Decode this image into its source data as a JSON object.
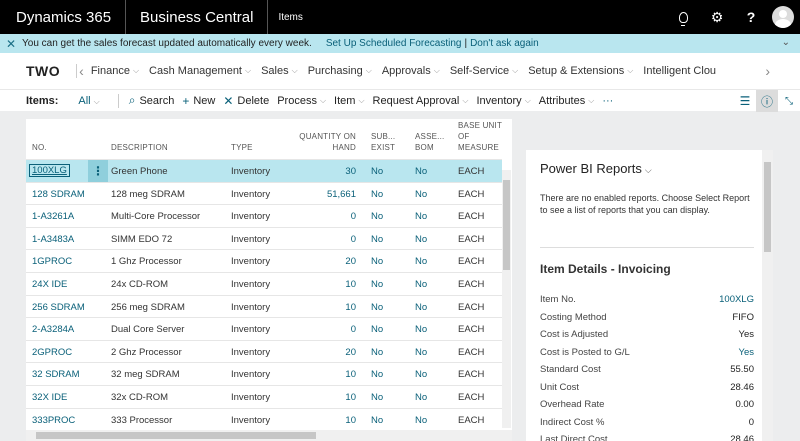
{
  "topbar": {
    "brand": "Dynamics 365",
    "app": "Business Central",
    "page": "Items"
  },
  "notification": {
    "text": "You can get the sales forecast updated automatically every week.",
    "link1": "Set Up Scheduled Forecasting",
    "sep": "|",
    "link2": "Don't ask again"
  },
  "nav": {
    "company": "TWO",
    "items": [
      "Finance",
      "Cash Management",
      "Sales",
      "Purchasing",
      "Approvals",
      "Self-Service",
      "Setup & Extensions",
      "Intelligent Clou"
    ]
  },
  "actions": {
    "title": "Items:",
    "filter": "All",
    "search": "Search",
    "new": "New",
    "delete": "Delete",
    "process": "Process",
    "item": "Item",
    "request_approval": "Request Approval",
    "inventory": "Inventory",
    "attributes": "Attributes",
    "more": "···"
  },
  "grid": {
    "headers": {
      "no": "NO.",
      "description": "DESCRIPTION",
      "type": "TYPE",
      "qty1": "QUANTITY ON",
      "qty2": "HAND",
      "sub1": "SUB...",
      "sub2": "EXIST",
      "asm1": "ASSE...",
      "asm2": "BOM",
      "uom1": "BASE UNIT",
      "uom2": "OF",
      "uom3": "MEASURE"
    },
    "rows": [
      {
        "no": "100XLG",
        "desc": "Green Phone",
        "type": "Inventory",
        "qty": "30",
        "sub": "No",
        "bom": "No",
        "uom": "EACH"
      },
      {
        "no": "128 SDRAM",
        "desc": "128 meg SDRAM",
        "type": "Inventory",
        "qty": "51,661",
        "sub": "No",
        "bom": "No",
        "uom": "EACH"
      },
      {
        "no": "1-A3261A",
        "desc": "Multi-Core Processor",
        "type": "Inventory",
        "qty": "0",
        "sub": "No",
        "bom": "No",
        "uom": "EACH"
      },
      {
        "no": "1-A3483A",
        "desc": "SIMM EDO 72",
        "type": "Inventory",
        "qty": "0",
        "sub": "No",
        "bom": "No",
        "uom": "EACH"
      },
      {
        "no": "1GPROC",
        "desc": "1 Ghz Processor",
        "type": "Inventory",
        "qty": "20",
        "sub": "No",
        "bom": "No",
        "uom": "EACH"
      },
      {
        "no": "24X IDE",
        "desc": "24x CD-ROM",
        "type": "Inventory",
        "qty": "10",
        "sub": "No",
        "bom": "No",
        "uom": "EACH"
      },
      {
        "no": "256 SDRAM",
        "desc": "256 meg SDRAM",
        "type": "Inventory",
        "qty": "10",
        "sub": "No",
        "bom": "No",
        "uom": "EACH"
      },
      {
        "no": "2-A3284A",
        "desc": "Dual Core Server",
        "type": "Inventory",
        "qty": "0",
        "sub": "No",
        "bom": "No",
        "uom": "EACH"
      },
      {
        "no": "2GPROC",
        "desc": "2 Ghz Processor",
        "type": "Inventory",
        "qty": "20",
        "sub": "No",
        "bom": "No",
        "uom": "EACH"
      },
      {
        "no": "32 SDRAM",
        "desc": "32 meg SDRAM",
        "type": "Inventory",
        "qty": "10",
        "sub": "No",
        "bom": "No",
        "uom": "EACH"
      },
      {
        "no": "32X IDE",
        "desc": "32x CD-ROM",
        "type": "Inventory",
        "qty": "10",
        "sub": "No",
        "bom": "No",
        "uom": "EACH"
      },
      {
        "no": "333PROC",
        "desc": "333 Processor",
        "type": "Inventory",
        "qty": "10",
        "sub": "No",
        "bom": "No",
        "uom": "EACH"
      }
    ]
  },
  "factbox": {
    "powerbi_title": "Power BI Reports",
    "powerbi_text": "There are no enabled reports. Choose Select Report to see a list of reports that you can display.",
    "invoicing_title": "Item Details - Invoicing",
    "fields": [
      {
        "label": "Item No.",
        "value": "100XLG",
        "link": true
      },
      {
        "label": "Costing Method",
        "value": "FIFO",
        "link": false
      },
      {
        "label": "Cost is Adjusted",
        "value": "Yes",
        "link": false
      },
      {
        "label": "Cost is Posted to G/L",
        "value": "Yes",
        "link": true
      },
      {
        "label": "Standard Cost",
        "value": "55.50",
        "link": false
      },
      {
        "label": "Unit Cost",
        "value": "28.46",
        "link": false
      },
      {
        "label": "Overhead Rate",
        "value": "0.00",
        "link": false
      },
      {
        "label": "Indirect Cost %",
        "value": "0",
        "link": false
      },
      {
        "label": "Last Direct Cost",
        "value": "28.46",
        "link": false
      }
    ]
  },
  "colors": {
    "accent": "#0a6079",
    "selected_row": "#b9e6ef",
    "notification": "#b9e6ef",
    "topbar": "#000000"
  },
  "icons": [
    "lightbulb-icon",
    "gear-icon",
    "help-icon",
    "avatar-icon",
    "close-icon",
    "chevron-down-icon",
    "search-icon",
    "plus-icon",
    "delete-icon",
    "list-view-icon",
    "info-icon",
    "collapse-icon"
  ]
}
